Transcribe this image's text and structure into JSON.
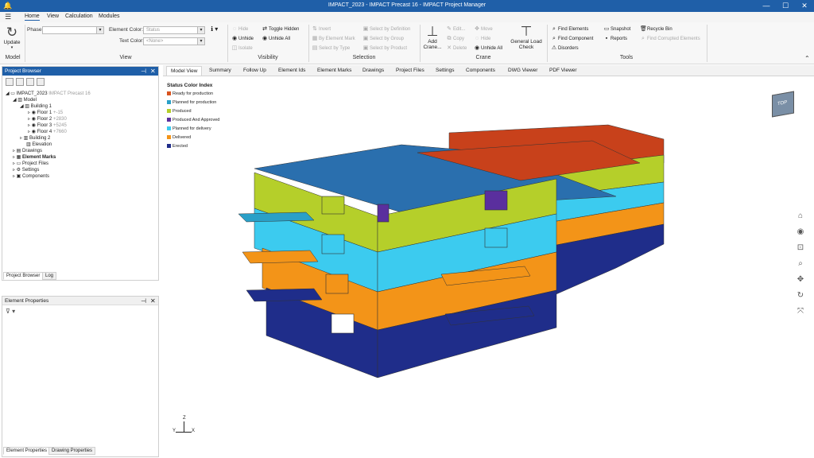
{
  "window": {
    "title": "IMPACT_2023 - IMPACT Precast 16 - IMPACT Project Manager",
    "app_icon": "bell-icon",
    "controls": {
      "minimize": "—",
      "maximize": "☐",
      "close": "✕"
    }
  },
  "menu": {
    "items": [
      "Home",
      "View",
      "Calculation",
      "Modules"
    ],
    "active": "Home"
  },
  "ribbon": {
    "model": {
      "update_label": "Update",
      "group": "Model"
    },
    "view": {
      "phase_label": "Phase:",
      "phase_value": "",
      "element_color_label": "Element Color:",
      "element_color_value": "Status",
      "text_color_label": "Text Color:",
      "text_color_value": "<None>",
      "group": "View"
    },
    "visibility": {
      "hide": "Hide",
      "unhide": "Unhide",
      "isolate": "Isolate",
      "toggle_hidden": "Toggle Hidden",
      "unhide_all": "Unhide All",
      "group": "Visibility"
    },
    "selection": {
      "invert": "Invert",
      "by_element_mark": "By Element Mark",
      "select_by_type": "Select by Type",
      "select_by_definition": "Select by Definition",
      "select_by_group": "Select by Group",
      "select_by_product": "Select by Product",
      "group": "Selection"
    },
    "crane": {
      "add_crane": "Add Crane...",
      "edit": "Edit...",
      "copy": "Copy",
      "delete": "Delete",
      "move": "Move",
      "hide": "Hide",
      "unhide_all": "Unhide All",
      "general_load_check": "General Load Check",
      "group": "Crane"
    },
    "tools": {
      "find_elements": "Find Elements",
      "find_component": "Find Component",
      "disorders": "Disorders",
      "snapshot": "Snapshot",
      "reports": "Reports",
      "recycle_bin": "Recycle Bin",
      "find_corrupted": "Find Corrupted Elements",
      "group": "Tools"
    }
  },
  "project_browser": {
    "title": "Project Browser",
    "tree": [
      {
        "label": "IMPACT_2023",
        "sub": "IMPACT Precast 16"
      },
      {
        "label": "Model",
        "sub": ""
      },
      {
        "label": "Building 1",
        "sub": ""
      },
      {
        "label": "Floor 1",
        "sub": "+-15"
      },
      {
        "label": "Floor 2",
        "sub": "+2830"
      },
      {
        "label": "Floor 3",
        "sub": "+5245"
      },
      {
        "label": "Floor 4",
        "sub": "+7660"
      },
      {
        "label": "Building 2",
        "sub": ""
      },
      {
        "label": "Elevation",
        "sub": ""
      },
      {
        "label": "Drawings",
        "sub": ""
      },
      {
        "label": "Element Marks",
        "sub": ""
      },
      {
        "label": "Project Files",
        "sub": ""
      },
      {
        "label": "Settings",
        "sub": ""
      },
      {
        "label": "Components",
        "sub": ""
      }
    ],
    "tabs": [
      "Project Browser",
      "Log"
    ]
  },
  "element_properties": {
    "title": "Element Properties",
    "tabs": [
      "Element Properties",
      "Drawing Properties"
    ]
  },
  "doc_tabs": [
    "Model View",
    "Summary",
    "Follow Up",
    "Element Ids",
    "Element Marks",
    "Drawings",
    "Project Files",
    "Settings",
    "Components",
    "DWG Viewer",
    "PDF Viewer"
  ],
  "active_doc_tab": "Model View",
  "legend": {
    "title": "Status Color Index",
    "items": [
      {
        "label": "Ready for production",
        "color": "#d9531e"
      },
      {
        "label": "Planned for production",
        "color": "#2aa0c8"
      },
      {
        "label": "Produced",
        "color": "#b5cf2a"
      },
      {
        "label": "Produced And Approved",
        "color": "#5a2f9e"
      },
      {
        "label": "Planned for delivery",
        "color": "#3ccbef"
      },
      {
        "label": "Delivered",
        "color": "#f39418"
      },
      {
        "label": "Erected",
        "color": "#1f2d8a"
      }
    ]
  },
  "viewcube_label": "TOP",
  "axis": {
    "z": "Z",
    "x": "X",
    "y": "Y"
  },
  "nav_icons": [
    "home-icon",
    "orbit-icon",
    "zoom-window-icon",
    "zoom-icon",
    "pan-icon",
    "rotate-icon",
    "fit-icon"
  ]
}
